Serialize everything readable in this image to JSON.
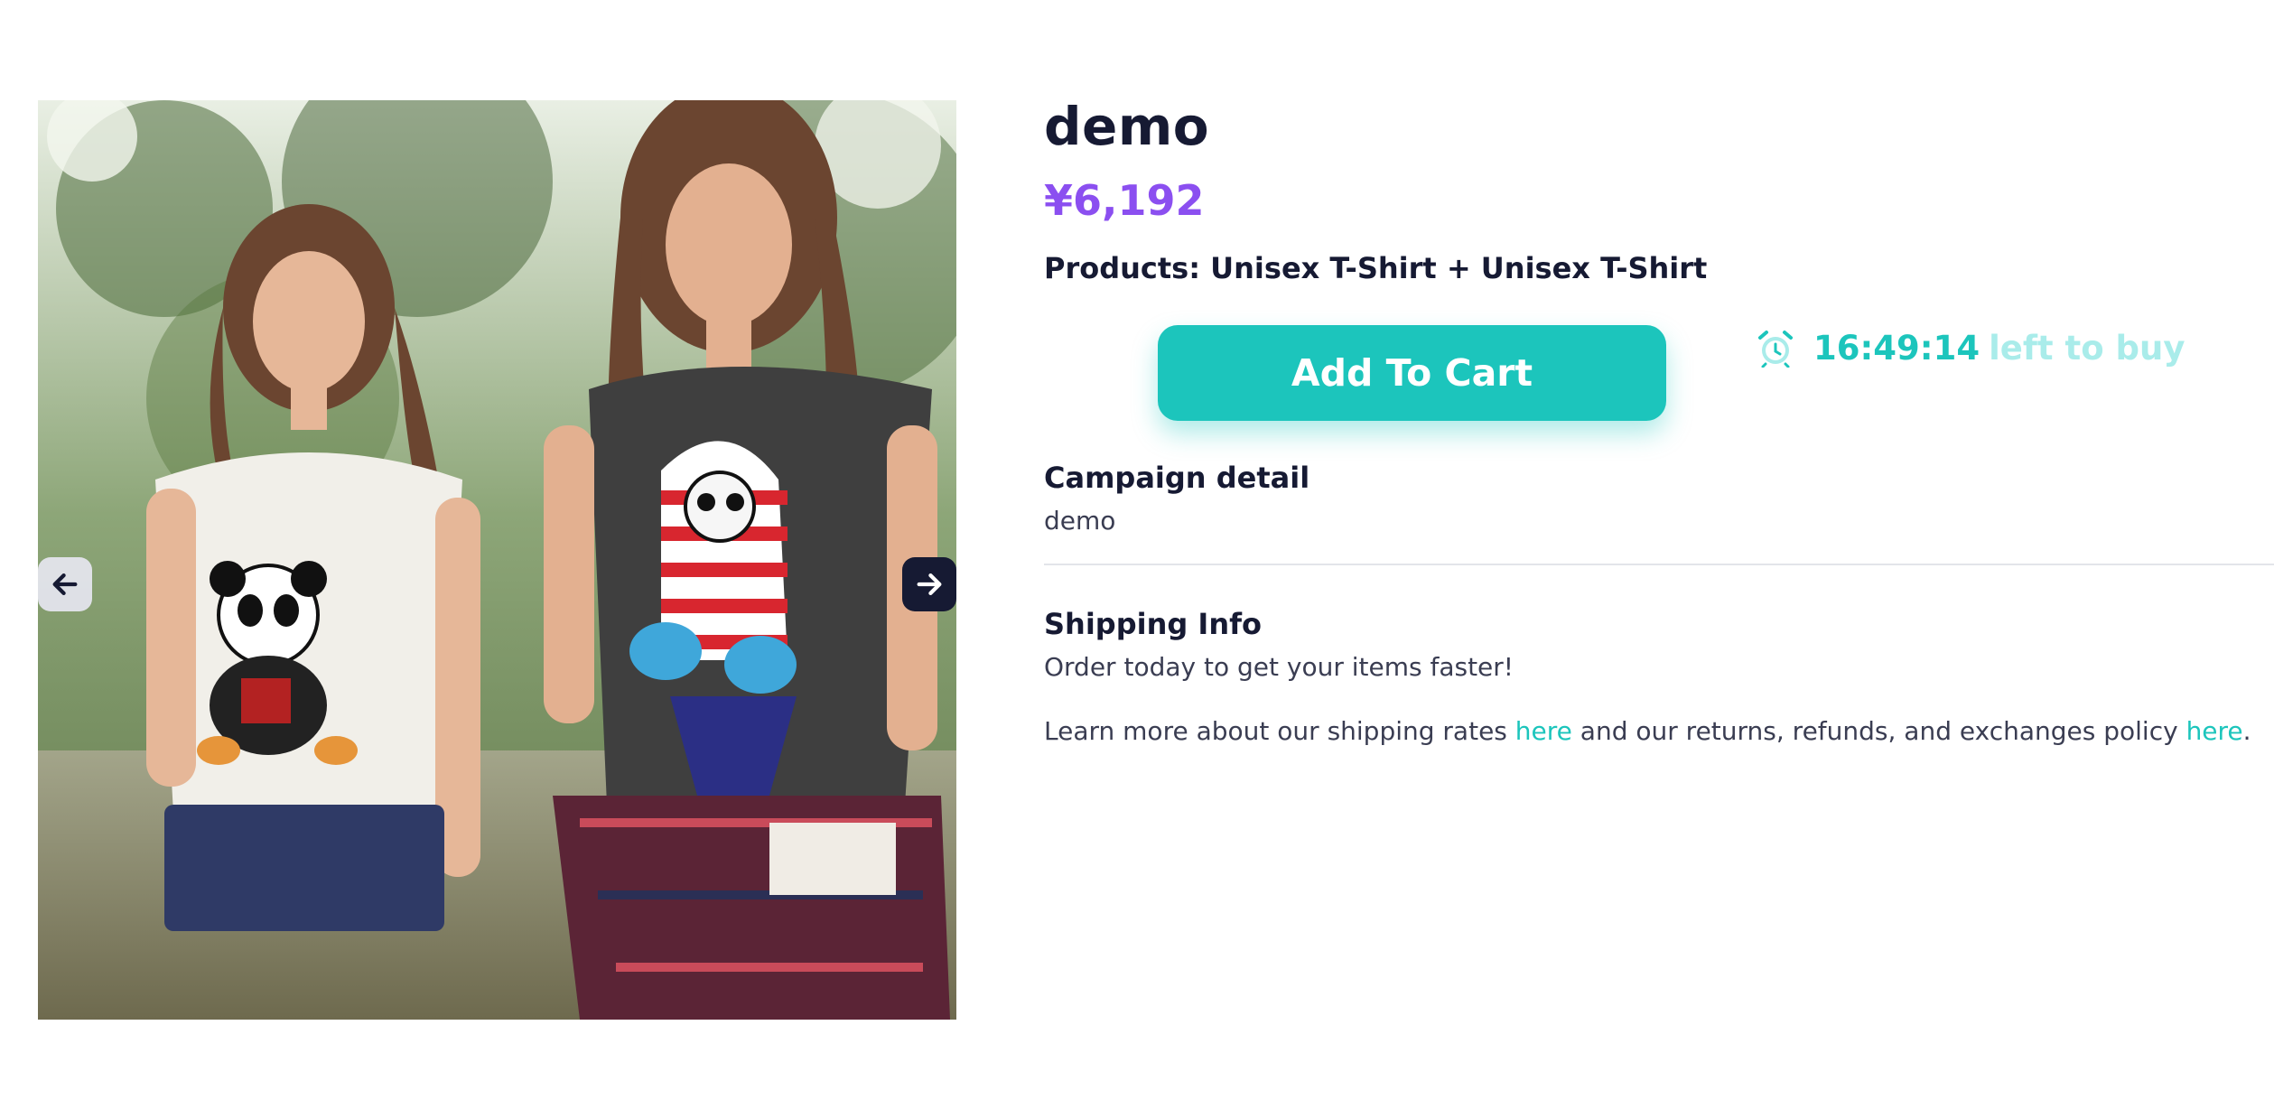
{
  "product": {
    "title": "demo",
    "price": "¥6,192",
    "products_line": "Products: Unisex T-Shirt + Unisex T-Shirt"
  },
  "cart": {
    "add_to_cart_label": "Add To Cart"
  },
  "timer": {
    "icon": "alarm-clock-icon",
    "time": "16:49:14",
    "suffix": "left to buy"
  },
  "gallery": {
    "prev_icon": "arrow-left-icon",
    "next_icon": "arrow-right-icon",
    "slide_count": 1,
    "active_slide": 1
  },
  "campaign": {
    "heading": "Campaign detail",
    "text": "demo"
  },
  "shipping": {
    "heading": "Shipping Info",
    "text": "Order today to get your items faster!",
    "learn_prefix": "Learn more about our shipping rates ",
    "link1": "here",
    "learn_middle": " and our returns, refunds, and exchanges policy ",
    "link2": "here",
    "learn_suffix": "."
  },
  "colors": {
    "accent": "#1cc5bc",
    "price": "#8b4ff0",
    "text": "#161a33"
  }
}
